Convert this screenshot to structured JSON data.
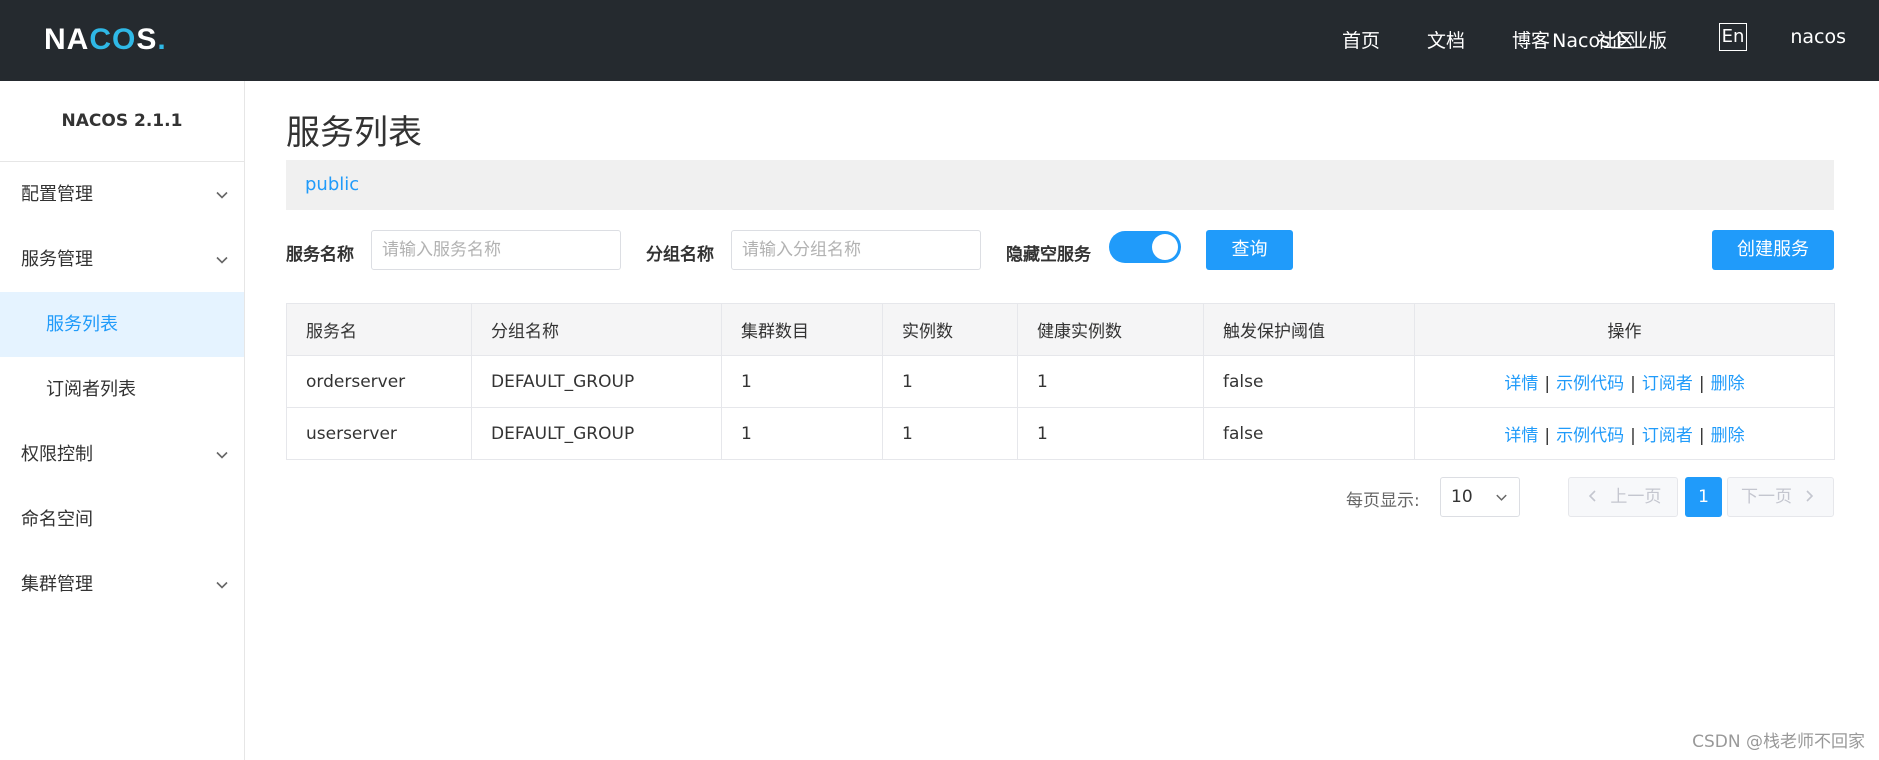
{
  "header": {
    "logo_text": "NACOS.",
    "nav": [
      "首页",
      "文档",
      "博客",
      "社区",
      "Nacos企业版"
    ],
    "lang_button": "En",
    "user": "nacos"
  },
  "sidebar": {
    "version": "NACOS 2.1.1",
    "items": [
      {
        "label": "配置管理",
        "has_children": true
      },
      {
        "label": "服务管理",
        "has_children": true
      },
      {
        "label": "服务列表",
        "sub": true,
        "active": true
      },
      {
        "label": "订阅者列表",
        "sub": true
      },
      {
        "label": "权限控制",
        "has_children": true
      },
      {
        "label": "命名空间",
        "has_children": false
      },
      {
        "label": "集群管理",
        "has_children": true
      }
    ]
  },
  "main": {
    "title": "服务列表",
    "namespace": "public",
    "filters": {
      "service_name_label": "服务名称",
      "service_name_placeholder": "请输入服务名称",
      "service_name_value": "",
      "group_name_label": "分组名称",
      "group_name_placeholder": "请输入分组名称",
      "group_name_value": "",
      "hide_empty_label": "隐藏空服务",
      "hide_empty_on": true,
      "query_button": "查询",
      "create_button": "创建服务"
    },
    "table": {
      "columns": [
        "服务名",
        "分组名称",
        "集群数目",
        "实例数",
        "健康实例数",
        "触发保护阈值",
        "操作"
      ],
      "rows": [
        [
          "orderserver",
          "DEFAULT_GROUP",
          "1",
          "1",
          "1",
          "false"
        ],
        [
          "userserver",
          "DEFAULT_GROUP",
          "1",
          "1",
          "1",
          "false"
        ]
      ],
      "operations": [
        "详情",
        "示例代码",
        "订阅者",
        "删除"
      ],
      "op_separator": "|"
    },
    "pagination": {
      "page_size_label": "每页显示:",
      "page_size": "10",
      "prev": "上一页",
      "next": "下一页",
      "current_page": "1"
    }
  },
  "watermark": "CSDN @栈老师不回家",
  "colors": {
    "header_bg": "#252a2f",
    "primary": "#209bfa",
    "active_bg": "#e5f3ff",
    "logo_accent": "#2fb8e6"
  }
}
